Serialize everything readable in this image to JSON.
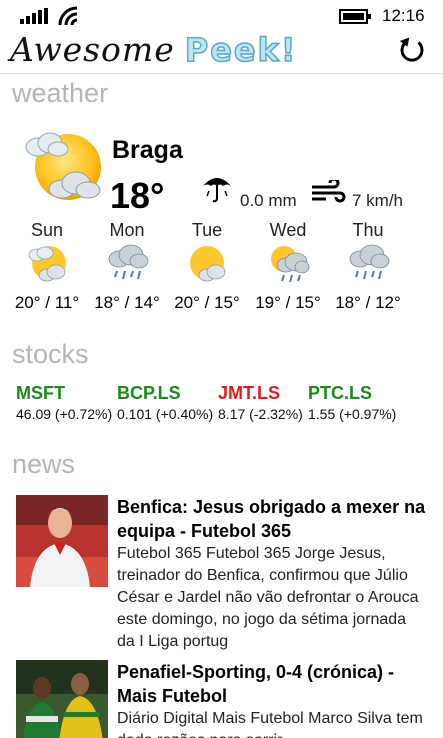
{
  "status_bar": {
    "time": "12:16"
  },
  "header": {
    "logo_part1": "Awesome",
    "logo_part2": "Peek!"
  },
  "sections": {
    "weather": "weather",
    "stocks": "stocks",
    "news": "news"
  },
  "weather": {
    "city": "Braga",
    "temperature": "18°",
    "rain": "0.0 mm",
    "wind": "7 km/h",
    "forecast": [
      {
        "day": "Sun",
        "range": "20° / 11°",
        "icon": "sun-cloud-icon"
      },
      {
        "day": "Mon",
        "range": "18° / 14°",
        "icon": "rain-cloud-icon"
      },
      {
        "day": "Tue",
        "range": "20° / 15°",
        "icon": "sun-cloud-icon"
      },
      {
        "day": "Wed",
        "range": "19° / 15°",
        "icon": "sun-rain-icon"
      },
      {
        "day": "Thu",
        "range": "18° / 12°",
        "icon": "rain-cloud-icon"
      }
    ]
  },
  "stocks": [
    {
      "symbol": "MSFT",
      "value": "46.09 (+0.72%)",
      "color": "#1b8a1b"
    },
    {
      "symbol": "BCP.LS",
      "value": "0.101 (+0.40%)",
      "color": "#1b8a1b"
    },
    {
      "symbol": "JMT.LS",
      "value": "8.17 (-2.32%)",
      "color": "#e01c1c"
    },
    {
      "symbol": "PTC.LS",
      "value": "1.55 (+0.97%)",
      "color": "#1b8a1b"
    }
  ],
  "news": [
    {
      "headline": "Benfica: Jesus obrigado a mexer na equipa - Futebol 365",
      "body": "Futebol 365     Futebol 365 Jorge Jesus, treinador do Benfica, confirmou que Júlio César e Jardel não vão defrontar o Arouca este domingo, no jogo da sétima jornada da I Liga portug"
    },
    {
      "headline": "Penafiel-Sporting, 0-4 (crónica) - Mais Futebol",
      "body": "Diário Digital     Mais Futebol Marco Silva tem dado razões para sorrir"
    }
  ]
}
